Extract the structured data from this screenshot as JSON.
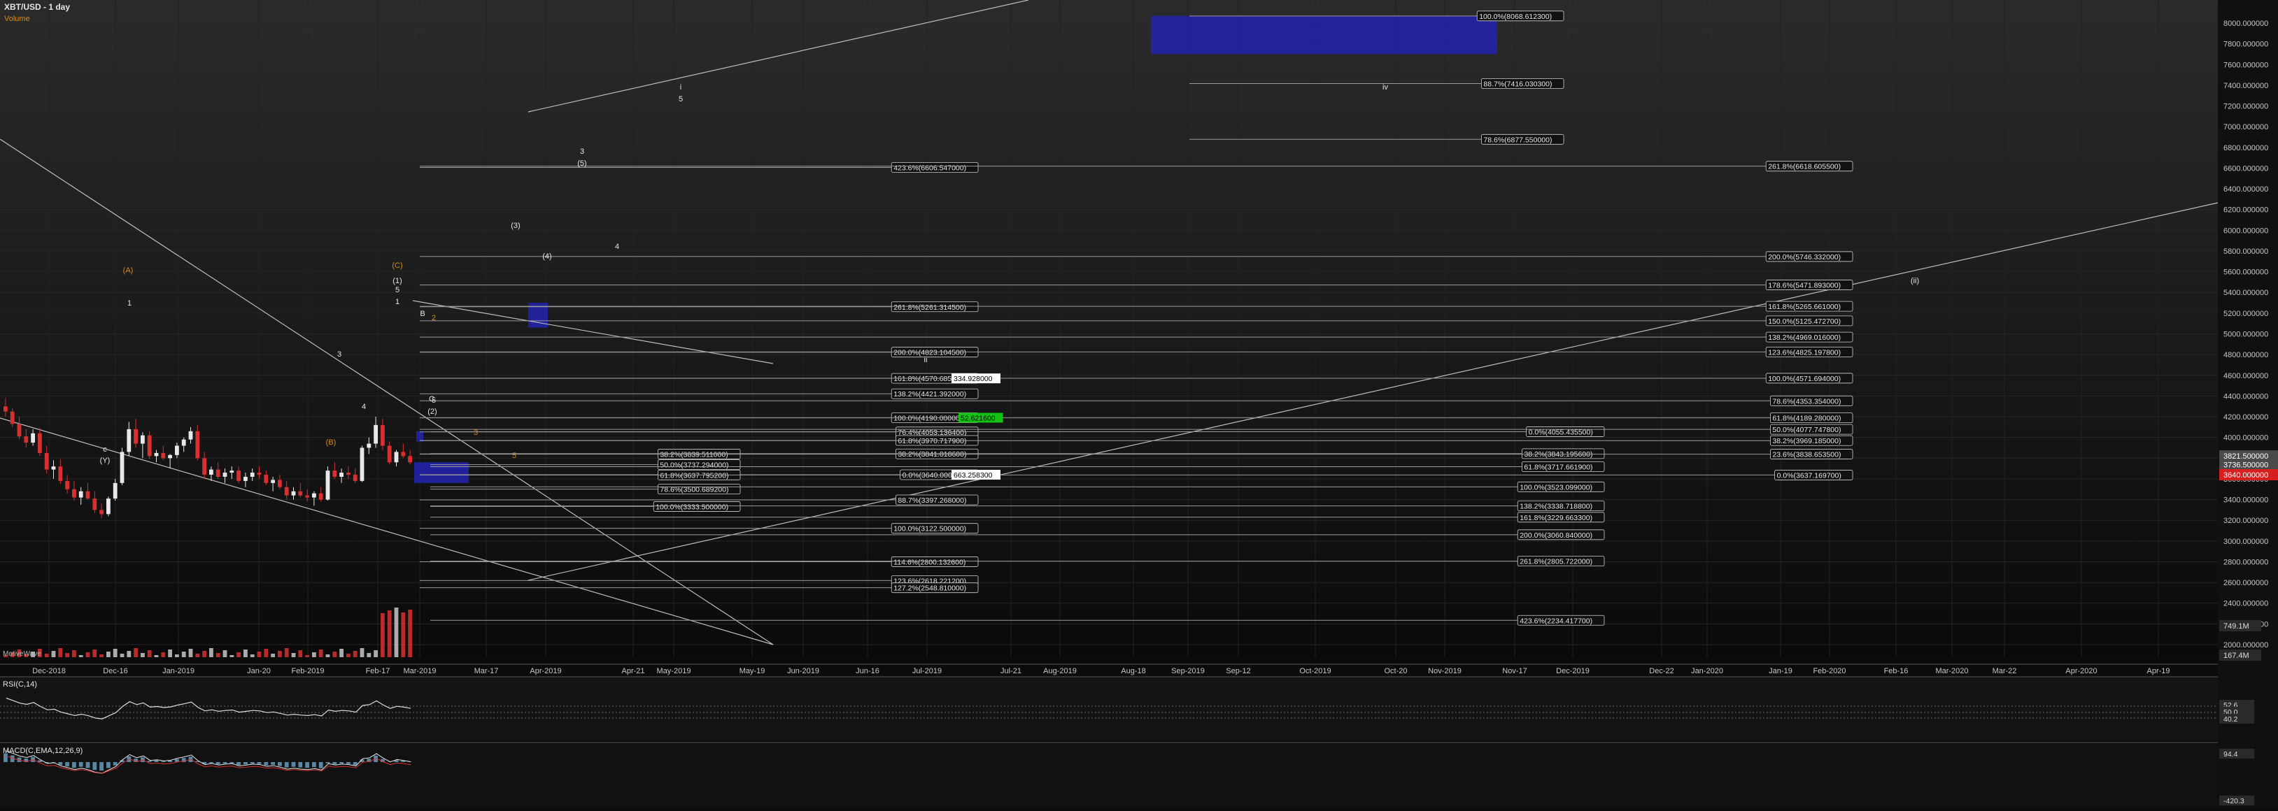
{
  "header": {
    "title": "XBT/USD - 1 day",
    "volume_label": "Volume"
  },
  "colors": {
    "up": "#e8e8e8",
    "down": "#d83030",
    "orange": "#d88a1c",
    "zone": "#2a2ab0",
    "grid": "#2c2c2c",
    "line": "#bdbdbd",
    "green": "#13c213",
    "red": "#d81f1f"
  },
  "axis": {
    "price_ticks": [
      "8000.000000",
      "7800.000000",
      "7600.000000",
      "7400.000000",
      "7200.000000",
      "7000.000000",
      "6800.000000",
      "6600.000000",
      "6400.000000",
      "6200.000000",
      "6000.000000",
      "5800.000000",
      "5600.000000",
      "5400.000000",
      "5200.000000",
      "5000.000000",
      "4800.000000",
      "4600.000000",
      "4400.000000",
      "4200.000000",
      "4000.000000",
      "3800.000000",
      "3600.000000",
      "3400.000000",
      "3200.000000",
      "3000.000000",
      "2800.000000",
      "2600.000000",
      "2400.000000",
      "2200.000000",
      "2000.000000"
    ],
    "price_badges": [
      {
        "value": 3821.5,
        "label": "3821.500000",
        "color": "#4a4a4a"
      },
      {
        "value": 3736.5,
        "label": "3736.500000",
        "color": "#4a4a4a"
      },
      {
        "value": 3640.0,
        "label": "3640.000000",
        "color": "#d81f1f"
      }
    ],
    "volume_badges": [
      "749.1M",
      "167.4M"
    ],
    "x_ticks": [
      "Dec-2018",
      "Dec-16",
      "Jan-2019",
      "Jan-20",
      "Feb-2019",
      "Feb-17",
      "Mar-2019",
      "Mar-17",
      "Apr-2019",
      "Apr-21",
      "May-2019",
      "May-19",
      "Jun-2019",
      "Jun-16",
      "Jul-2019",
      "Jul-21",
      "Aug-2019",
      "Aug-18",
      "Sep-2019",
      "Sep-12",
      "Oct-2019",
      "Oct-20",
      "Nov-2019",
      "Nov-17",
      "Dec-2019",
      "Dec-22",
      "Jan-2020",
      "Jan-19",
      "Feb-2020",
      "Feb-16",
      "Mar-2020",
      "Mar-22",
      "Apr-2020",
      "Apr-19"
    ]
  },
  "chart_data": {
    "type": "candlestick",
    "symbol": "XBT/USD",
    "interval": "1 day",
    "ylim": [
      1900,
      8150
    ],
    "candles_ohlc": [
      [
        4300,
        4380,
        4200,
        4250
      ],
      [
        4250,
        4280,
        4100,
        4130
      ],
      [
        4130,
        4200,
        3980,
        4010
      ],
      [
        4010,
        4080,
        3900,
        3950
      ],
      [
        3950,
        4080,
        3920,
        4040
      ],
      [
        4040,
        4090,
        3820,
        3850
      ],
      [
        3850,
        3920,
        3650,
        3690
      ],
      [
        3690,
        3780,
        3600,
        3720
      ],
      [
        3720,
        3790,
        3550,
        3580
      ],
      [
        3580,
        3640,
        3460,
        3500
      ],
      [
        3500,
        3580,
        3390,
        3420
      ],
      [
        3420,
        3520,
        3350,
        3480
      ],
      [
        3480,
        3560,
        3400,
        3410
      ],
      [
        3410,
        3480,
        3270,
        3300
      ],
      [
        3300,
        3360,
        3220,
        3260
      ],
      [
        3260,
        3430,
        3240,
        3410
      ],
      [
        3410,
        3600,
        3390,
        3560
      ],
      [
        3560,
        3900,
        3540,
        3860
      ],
      [
        3860,
        4150,
        3820,
        4080
      ],
      [
        4080,
        4180,
        3900,
        3940
      ],
      [
        3940,
        4050,
        3800,
        4020
      ],
      [
        4020,
        4060,
        3790,
        3820
      ],
      [
        3820,
        3880,
        3760,
        3850
      ],
      [
        3850,
        3920,
        3780,
        3800
      ],
      [
        3800,
        3840,
        3700,
        3830
      ],
      [
        3830,
        3950,
        3800,
        3920
      ],
      [
        3920,
        4000,
        3860,
        3980
      ],
      [
        3980,
        4100,
        3940,
        4060
      ],
      [
        4060,
        4120,
        3780,
        3800
      ],
      [
        3800,
        3860,
        3600,
        3640
      ],
      [
        3640,
        3720,
        3580,
        3690
      ],
      [
        3690,
        3760,
        3600,
        3620
      ],
      [
        3620,
        3700,
        3560,
        3660
      ],
      [
        3660,
        3720,
        3600,
        3680
      ],
      [
        3680,
        3720,
        3560,
        3580
      ],
      [
        3580,
        3660,
        3520,
        3620
      ],
      [
        3620,
        3700,
        3580,
        3660
      ],
      [
        3660,
        3720,
        3600,
        3640
      ],
      [
        3640,
        3680,
        3540,
        3560
      ],
      [
        3560,
        3620,
        3480,
        3590
      ],
      [
        3590,
        3640,
        3500,
        3520
      ],
      [
        3520,
        3580,
        3400,
        3440
      ],
      [
        3440,
        3520,
        3400,
        3480
      ],
      [
        3480,
        3560,
        3420,
        3440
      ],
      [
        3440,
        3500,
        3380,
        3420
      ],
      [
        3420,
        3480,
        3340,
        3460
      ],
      [
        3460,
        3520,
        3380,
        3400
      ],
      [
        3400,
        3720,
        3390,
        3680
      ],
      [
        3680,
        3760,
        3600,
        3620
      ],
      [
        3620,
        3700,
        3560,
        3660
      ],
      [
        3660,
        3720,
        3600,
        3640
      ],
      [
        3640,
        3700,
        3560,
        3580
      ],
      [
        3580,
        3920,
        3570,
        3900
      ],
      [
        3900,
        4000,
        3840,
        3940
      ],
      [
        3940,
        4200,
        3900,
        4120
      ],
      [
        4120,
        4180,
        3880,
        3920
      ],
      [
        3920,
        3960,
        3740,
        3760
      ],
      [
        3760,
        3880,
        3720,
        3860
      ],
      [
        3860,
        3940,
        3800,
        3820
      ],
      [
        3820,
        3880,
        3740,
        3760
      ]
    ],
    "fib_levels_left": [
      "423.6%(6606.547000)",
      "261.8%(5261.314500)",
      "200.0%(4823.104500)",
      "161.8%(4570.685500)",
      "138.2%(4421.392000)",
      "100.0%(4190.000000)",
      "76.4%(4053.136400)",
      "61.8%(3970.717900)",
      "38.2%(3841.018600)",
      "0.0%(3640.000000)",
      "88.7%(3397.268000)",
      "100.0%(3122.500000)",
      "114.6%(2800.132600)",
      "123.6%(2618.221200)",
      "127.2%(2548.810000)"
    ],
    "fib_levels_mid": [
      "38.2%(3839.511000)",
      "50.0%(3737.294000)",
      "61.8%(3637.795200)",
      "78.6%(3500.689200)",
      "100.0%(3333.500000)"
    ],
    "fib_levels_right": [
      "0.0%(4055.435500)",
      "38.2%(3843.195600)",
      "61.8%(3717.661900)",
      "100.0%(3523.099000)",
      "138.2%(3338.718800)",
      "161.8%(3229.663300)",
      "200.0%(3060.840000)",
      "261.8%(2805.722000)",
      "423.6%(2234.417700)"
    ],
    "fib_levels_far": [
      "261.8%(6618.605500)",
      "200.0%(5746.332000)",
      "178.6%(5471.893000)",
      "161.8%(5265.661000)",
      "150.0%(5125.472700)",
      "138.2%(4969.016000)",
      "123.6%(4825.197800)",
      "100.0%(4571.694000)",
      "78.6%(4353.354000)",
      "61.8%(4189.280000)",
      "50.0%(4077.747800)",
      "38.2%(3969.185000)",
      "23.6%(3838.653500)",
      "0.0%(3637.169700)"
    ],
    "fib_levels_top": [
      "100.0%(8068.612300)",
      "88.7%(7416.030300)",
      "78.6%(6877.550000)"
    ],
    "tag_boxes": [
      "334.928000",
      "52.621600",
      "663.258300"
    ],
    "wave_labels": [
      "(A)",
      "1",
      "(C)",
      "(1)",
      "5",
      "1",
      "B",
      "2",
      "3",
      "4",
      "5",
      "C",
      "(2)",
      "3",
      "5",
      "(B)",
      "c",
      "(Y)",
      "i",
      "5",
      "3",
      "(5)",
      "(3)",
      "(4)",
      "4",
      "ii",
      "iv",
      "(ii)"
    ],
    "indicators": {
      "volume_title": "MotiveWave",
      "rsi": {
        "label": "RSI(C,14)",
        "levels": [
          "52.6",
          "50.0",
          "40.2"
        ]
      },
      "macd": {
        "label": "MACD(C,EMA,12,26,9)",
        "levels": [
          "94.4",
          "-420.3"
        ]
      }
    }
  }
}
